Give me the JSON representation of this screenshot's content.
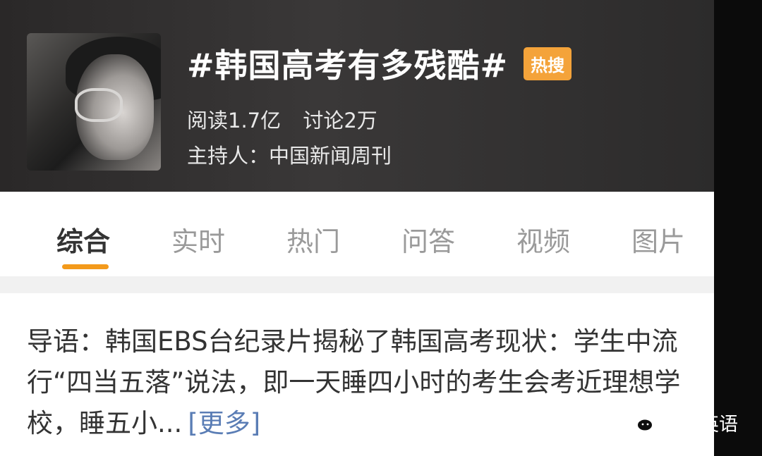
{
  "topic": {
    "title": "#韩国高考有多残酷#",
    "badge": "热搜",
    "reads": "阅读1.7亿",
    "discussions": "讨论2万",
    "host": "主持人：中国新闻周刊"
  },
  "tabs": [
    {
      "label": "综合",
      "active": true
    },
    {
      "label": "实时",
      "active": false
    },
    {
      "label": "热门",
      "active": false
    },
    {
      "label": "问答",
      "active": false
    },
    {
      "label": "视频",
      "active": false
    },
    {
      "label": "图片",
      "active": false
    }
  ],
  "intro": {
    "text": "导语：韩国EBS台纪录片揭秘了韩国高考现状：学生中流行“四当五落”说法，即一天睡四小时的考生会考近理想学校，睡五小...",
    "more": "[更多]"
  },
  "watermark": {
    "text": "毒舌英语",
    "icon": "wechat-icon"
  },
  "colors": {
    "accent": "#f39a1b",
    "badge": "#f4a33a",
    "link": "#5a7db5"
  }
}
